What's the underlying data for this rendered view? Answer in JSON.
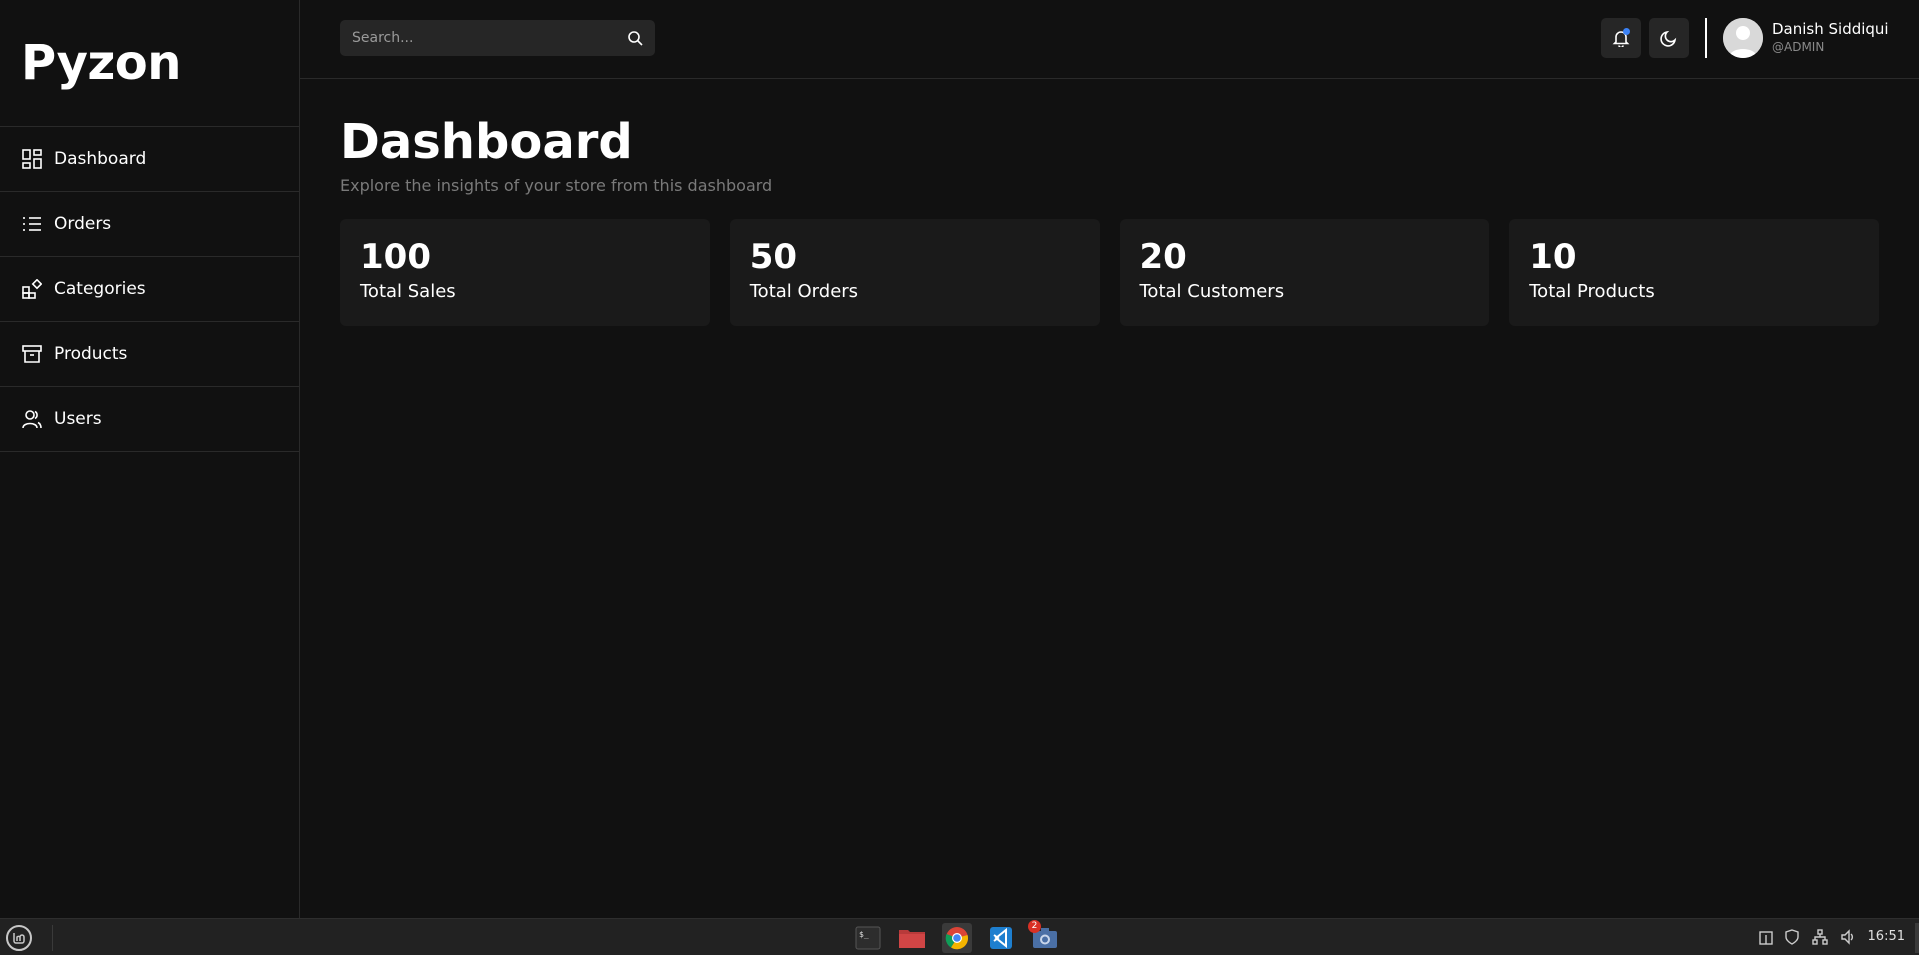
{
  "sidebar": {
    "brand": "Pyzon",
    "items": [
      {
        "label": "Dashboard",
        "icon": "dashboard-icon"
      },
      {
        "label": "Orders",
        "icon": "list-icon"
      },
      {
        "label": "Categories",
        "icon": "categories-icon"
      },
      {
        "label": "Products",
        "icon": "archive-icon"
      },
      {
        "label": "Users",
        "icon": "users-icon"
      }
    ]
  },
  "topbar": {
    "search_placeholder": "Search...",
    "user_name": "Danish Siddiqui",
    "user_role": "@ADMIN",
    "notification_dot_color": "#3b82f6"
  },
  "main": {
    "title": "Dashboard",
    "subtitle": "Explore the insights of your store from this dashboard",
    "stats": [
      {
        "value": "100",
        "label": "Total Sales"
      },
      {
        "value": "50",
        "label": "Total Orders"
      },
      {
        "value": "20",
        "label": "Total Customers"
      },
      {
        "value": "10",
        "label": "Total Products"
      }
    ]
  },
  "taskbar": {
    "apps": [
      "terminal-icon",
      "files-icon",
      "chrome-icon",
      "vscode-icon",
      "screenshot-icon"
    ],
    "screenshot_badge": "2",
    "clock": "16:51"
  },
  "colors": {
    "background": "#111111",
    "card": "#1a1a1a",
    "border": "#2a2a2a"
  }
}
